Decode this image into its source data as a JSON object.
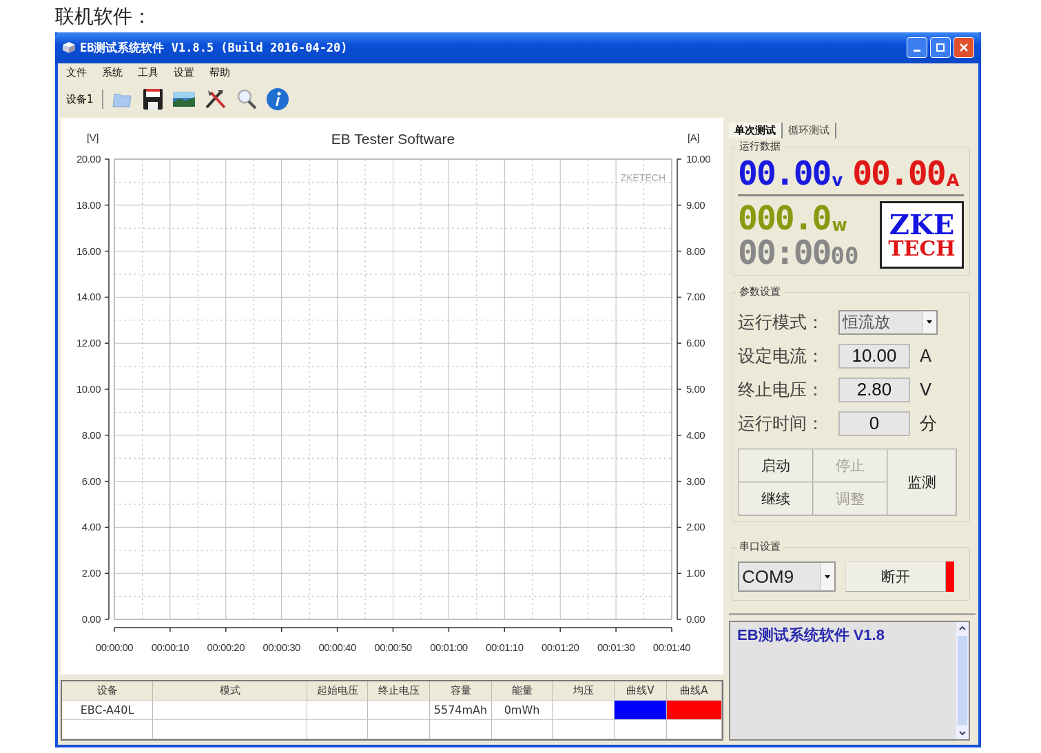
{
  "page_heading": "联机软件：",
  "window": {
    "title": "EB测试系统软件 V1.8.5 (Build 2016-04-20)"
  },
  "menu": [
    "文件",
    "系统",
    "工具",
    "设置",
    "帮助"
  ],
  "toolbar": {
    "device_label": "设备1"
  },
  "chart": {
    "watermark": "ZKETECH",
    "chart_data": {
      "type": "line",
      "grid": true,
      "title": "EB Tester Software",
      "ylabel": "[V]",
      "y2label": "[A]",
      "xlim": [
        0,
        100
      ],
      "ylim": [
        0,
        20
      ],
      "y2lim": [
        0,
        10
      ],
      "xticks": [
        {
          "value": 0,
          "label": "00:00:00"
        },
        {
          "value": 10,
          "label": "00:00:10"
        },
        {
          "value": 20,
          "label": "00:00:20"
        },
        {
          "value": 30,
          "label": "00:00:30"
        },
        {
          "value": 40,
          "label": "00:00:40"
        },
        {
          "value": 50,
          "label": "00:00:50"
        },
        {
          "value": 60,
          "label": "00:01:00"
        },
        {
          "value": 70,
          "label": "00:01:10"
        },
        {
          "value": 80,
          "label": "00:01:20"
        },
        {
          "value": 90,
          "label": "00:01:30"
        },
        {
          "value": 100,
          "label": "00:01:40"
        }
      ],
      "yticks": [
        {
          "value": 0,
          "label": "0.00"
        },
        {
          "value": 2,
          "label": "2.00"
        },
        {
          "value": 4,
          "label": "4.00"
        },
        {
          "value": 6,
          "label": "6.00"
        },
        {
          "value": 8,
          "label": "8.00"
        },
        {
          "value": 10,
          "label": "10.00"
        },
        {
          "value": 12,
          "label": "12.00"
        },
        {
          "value": 14,
          "label": "14.00"
        },
        {
          "value": 16,
          "label": "16.00"
        },
        {
          "value": 18,
          "label": "18.00"
        },
        {
          "value": 20,
          "label": "20.00"
        }
      ],
      "y2ticks": [
        {
          "value": 0,
          "label": "0.00"
        },
        {
          "value": 1,
          "label": "1.00"
        },
        {
          "value": 2,
          "label": "2.00"
        },
        {
          "value": 3,
          "label": "3.00"
        },
        {
          "value": 4,
          "label": "4.00"
        },
        {
          "value": 5,
          "label": "5.00"
        },
        {
          "value": 6,
          "label": "6.00"
        },
        {
          "value": 7,
          "label": "7.00"
        },
        {
          "value": 8,
          "label": "8.00"
        },
        {
          "value": 9,
          "label": "9.00"
        },
        {
          "value": 10,
          "label": "10.00"
        }
      ]
    }
  },
  "table": {
    "columns": [
      "设备",
      "模式",
      "起始电压",
      "终止电压",
      "容量",
      "能量",
      "均压",
      "曲线V",
      "曲线A"
    ],
    "rows": [
      {
        "device": "EBC-A40L",
        "capacity": "5574mAh",
        "energy": "0mWh",
        "curves": [
          {
            "color": "#0000ff"
          },
          {
            "color": "#ff0000"
          }
        ]
      }
    ]
  },
  "tabs": [
    {
      "label": "单次测试",
      "selected": true
    },
    {
      "label": "循环测试",
      "selected": false
    }
  ],
  "run_data": {
    "title": "运行数据",
    "voltage": {
      "value": "00.00",
      "unit": "v"
    },
    "current": {
      "value": "00.00",
      "unit": "A"
    },
    "power": {
      "value": "000.0",
      "unit": "w"
    },
    "time": {
      "value": "00:00",
      "seconds": "00"
    },
    "logo": {
      "line1": "ZKE",
      "line2": "TECH"
    }
  },
  "params": {
    "title": "参数设置",
    "fields": [
      {
        "label": "运行模式：",
        "value": "恒流放",
        "kind": "dropdown"
      },
      {
        "label": "设定电流：",
        "value": "10.00",
        "unit": "A",
        "kind": "input"
      },
      {
        "label": "终止电压：",
        "value": "2.80",
        "unit": "V",
        "kind": "input"
      },
      {
        "label": "运行时间：",
        "value": "0",
        "unit": "分",
        "kind": "input"
      }
    ]
  },
  "buttons": [
    {
      "label": "启动",
      "disabled": false
    },
    {
      "label": "停止",
      "disabled": true
    },
    {
      "label": "继续",
      "disabled": false
    },
    {
      "label": "调整",
      "disabled": true
    }
  ],
  "monitor_button": {
    "label": "监测"
  },
  "serial": {
    "title": "串口设置",
    "port": "COM9",
    "button": "断开",
    "connected": true
  },
  "log": {
    "lines": [
      "EB测试系统软件 V1.8"
    ]
  }
}
